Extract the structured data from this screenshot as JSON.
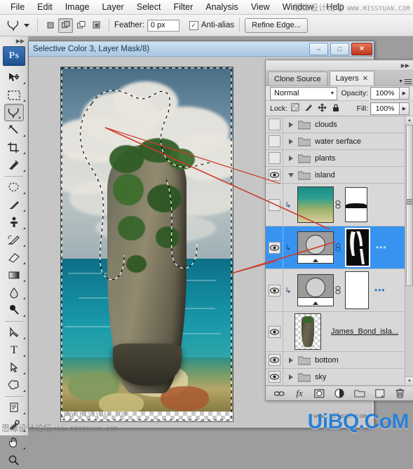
{
  "menubar": {
    "items": [
      {
        "label": "File"
      },
      {
        "label": "Edit"
      },
      {
        "label": "Image"
      },
      {
        "label": "Layer"
      },
      {
        "label": "Select"
      },
      {
        "label": "Filter"
      },
      {
        "label": "Analysis"
      },
      {
        "label": "View"
      },
      {
        "label": "Window"
      },
      {
        "label": "Help"
      }
    ]
  },
  "options_bar": {
    "tool_icon": "lasso-tool-icon",
    "selection_modes": [
      "new-selection",
      "add-to-selection",
      "subtract-from-selection",
      "intersect-selection"
    ],
    "active_selection_mode": "add-to-selection",
    "feather_label": "Feather:",
    "feather_value": "0 px",
    "antialias_label": "Anti-alias",
    "antialias_checked": true,
    "refine_edge_label": "Refine Edge..."
  },
  "toolbar": {
    "logo": "Ps",
    "tools": [
      {
        "name": "move-tool"
      },
      {
        "name": "rectangular-marquee-tool"
      },
      {
        "name": "lasso-tool",
        "selected": true
      },
      {
        "name": "magic-wand-tool"
      },
      {
        "name": "crop-tool"
      },
      {
        "name": "healing-brush-tool"
      },
      {
        "name": "patch-tool"
      },
      {
        "name": "brush-tool"
      },
      {
        "name": "clone-stamp-tool"
      },
      {
        "name": "history-brush-tool"
      },
      {
        "name": "eraser-tool"
      },
      {
        "name": "gradient-tool"
      },
      {
        "name": "blur-tool"
      },
      {
        "name": "dodge-tool"
      },
      {
        "name": "pen-tool"
      },
      {
        "name": "type-tool"
      },
      {
        "name": "path-selection-tool"
      },
      {
        "name": "shape-tool"
      },
      {
        "name": "notes-tool"
      },
      {
        "name": "eyedropper-tool"
      },
      {
        "name": "hand-tool"
      },
      {
        "name": "zoom-tool"
      }
    ]
  },
  "document_window": {
    "title": "Selective Color 3, Layer Mask/8)",
    "window_buttons": [
      {
        "name": "minimize-button",
        "glyph": "–"
      },
      {
        "name": "maximize-button",
        "glyph": "□"
      },
      {
        "name": "close-button",
        "glyph": "✕"
      }
    ]
  },
  "layers_panel": {
    "tabs": [
      {
        "label": "Clone Source",
        "active": false,
        "closable": false
      },
      {
        "label": "Layers",
        "active": true,
        "closable": true,
        "close_glyph": "✕"
      }
    ],
    "blend_mode": "Normal",
    "opacity_label": "Opacity:",
    "opacity_value": "100%",
    "lock_label": "Lock:",
    "lock_icons": [
      "lock-transparent-pixels-icon",
      "lock-image-pixels-icon",
      "lock-position-icon",
      "lock-all-icon"
    ],
    "fill_label": "Fill:",
    "fill_value": "100%",
    "layers": [
      {
        "name": "clouds",
        "type": "group",
        "visible": false,
        "expanded": false,
        "selected": false
      },
      {
        "name": "water serface",
        "type": "group",
        "visible": false,
        "expanded": false,
        "selected": false
      },
      {
        "name": "plants",
        "type": "group",
        "visible": false,
        "expanded": false,
        "selected": false
      },
      {
        "name": "island",
        "type": "group",
        "visible": true,
        "expanded": true,
        "selected": false
      },
      {
        "name": "",
        "type": "pixel-layer-with-mask",
        "visible": false,
        "clipped": true,
        "selected": false,
        "thumb": "reef-photo-thumbnail",
        "mask": "partial-black-white-mask"
      },
      {
        "name": "",
        "type": "selective-color-adjustment-with-mask",
        "visible": true,
        "clipped": true,
        "selected": true,
        "thumb": "selective-color-adjustment-thumbnail",
        "mask": "black-with-white-strokes-mask",
        "extra": "•••"
      },
      {
        "name": "",
        "type": "selective-color-adjustment-with-mask",
        "visible": true,
        "clipped": true,
        "selected": false,
        "thumb": "selective-color-adjustment-thumbnail",
        "mask": "white-mask",
        "extra": "•••"
      },
      {
        "name": "James_Bond_isla...",
        "type": "pixel-layer",
        "visible": true,
        "selected": false,
        "thumb": "island-rock-thumbnail"
      },
      {
        "name": "bottom",
        "type": "group",
        "visible": true,
        "expanded": false,
        "selected": false
      },
      {
        "name": "sky",
        "type": "group",
        "visible": true,
        "expanded": false,
        "selected": false
      }
    ],
    "bottom_buttons": [
      {
        "name": "link-layers-button",
        "glyph": "⚭"
      },
      {
        "name": "layer-style-button",
        "glyph": "fx"
      },
      {
        "name": "add-layer-mask-button",
        "glyph": "□"
      },
      {
        "name": "new-adjustment-layer-button",
        "glyph": "◑"
      },
      {
        "name": "new-group-button",
        "glyph": "▭"
      },
      {
        "name": "new-layer-button",
        "glyph": "⧉"
      },
      {
        "name": "delete-layer-button",
        "glyph": "Ὕ1"
      }
    ]
  },
  "watermarks": {
    "cn_text": "思缘设计论坛",
    "url_text": "WWW.MISSYUAN.COM",
    "site_big": "UiBQ.CoM",
    "site_small": "www.uiload.com"
  },
  "colors": {
    "selection_blue": "#3893f0",
    "title_bar": "#a9c7e4",
    "panel_gray": "#d4d4d4",
    "accent_watermark": "#2a7fd4",
    "pointer_line": "#cc3b2b"
  }
}
